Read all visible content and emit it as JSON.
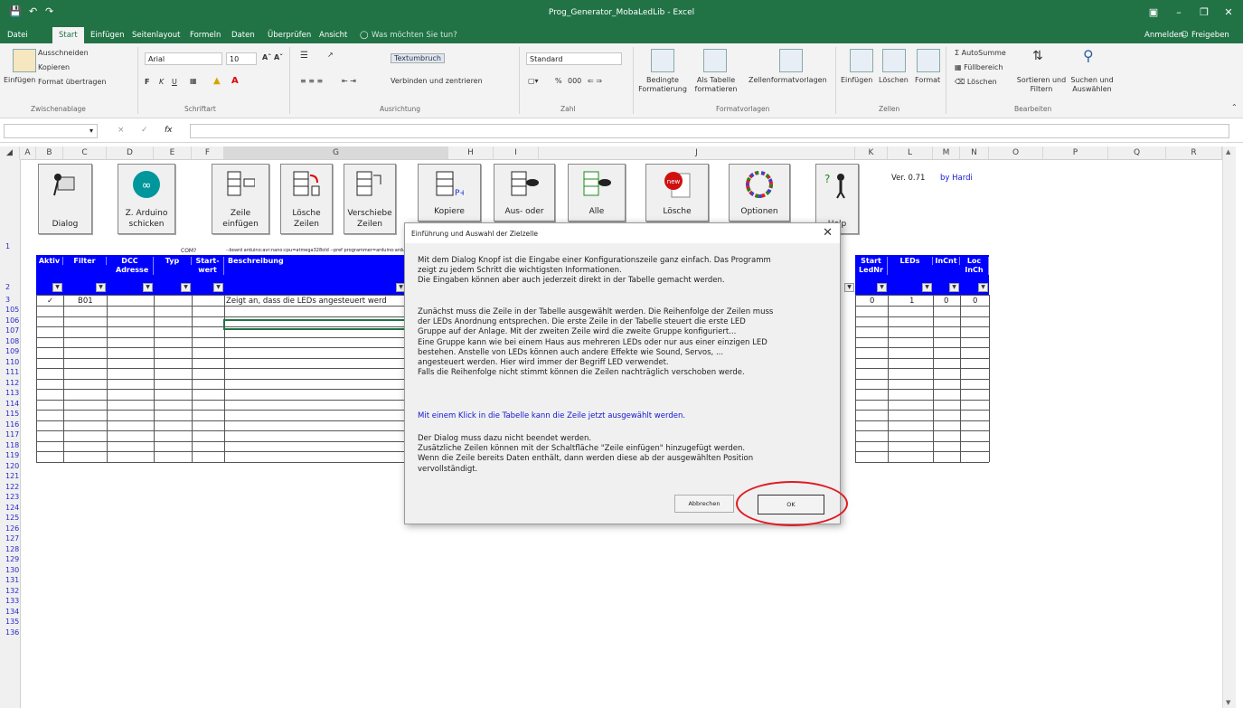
{
  "titlebar": {
    "title": "Prog_Generator_MobaLedLib - Excel",
    "save_icon": "save-icon",
    "undo_icon": "undo-icon",
    "redo_icon": "redo-icon"
  },
  "menu": {
    "items": [
      "Datei",
      "Start",
      "Einfügen",
      "Seitenlayout",
      "Formeln",
      "Daten",
      "Überprüfen",
      "Ansicht"
    ],
    "tell_me": "Was möchten Sie tun?",
    "sign_in": "Anmelden",
    "share": "Freigeben"
  },
  "ribbon": {
    "clipboard": {
      "paste": "Einfügen",
      "cut": "Ausschneiden",
      "copy": "Kopieren",
      "format": "Format übertragen",
      "group": "Zwischenablage"
    },
    "font": {
      "name": "Arial",
      "size": "10",
      "bold": "F",
      "italic": "K",
      "underline": "U",
      "group": "Schriftart"
    },
    "alignment": {
      "wrap": "Textumbruch",
      "merge": "Verbinden und zentrieren",
      "group": "Ausrichtung"
    },
    "number": {
      "format": "Standard",
      "percent": "%",
      "thousands": "000",
      "group": "Zahl"
    },
    "styles": {
      "conditional": "Bedingte Formatierung",
      "as_table": "Als Tabelle formatieren",
      "cell_styles": "Zellenformatvorlagen",
      "group": "Formatvorlagen"
    },
    "cells": {
      "insert": "Einfügen",
      "delete": "Löschen",
      "format": "Format",
      "group": "Zellen"
    },
    "editing": {
      "autosum": "AutoSumme",
      "fill": "Füllbereich",
      "clear": "Löschen",
      "sort": "Sortieren und Filtern",
      "find": "Suchen und Auswählen",
      "group": "Bearbeiten"
    }
  },
  "formula": {
    "cancel": "×",
    "enter": "✓",
    "fx": "fx",
    "value": ""
  },
  "columns": [
    "A",
    "B",
    "C",
    "D",
    "E",
    "F",
    "G",
    "H",
    "I",
    "J",
    "K",
    "L",
    "M",
    "N",
    "O",
    "P",
    "Q",
    "R"
  ],
  "rows": [
    "1",
    "2",
    "3",
    "105",
    "106",
    "107",
    "108",
    "109",
    "110",
    "111",
    "112",
    "113",
    "114",
    "115",
    "116",
    "117",
    "118",
    "119",
    "120",
    "121",
    "122",
    "123",
    "124",
    "125",
    "126",
    "127",
    "128",
    "129",
    "130",
    "131",
    "132",
    "133",
    "134",
    "135",
    "136"
  ],
  "sheet_buttons": [
    {
      "label": "Dialog"
    },
    {
      "label": "Z. Arduino\nschicken"
    },
    {
      "label": "Zeile\neinfügen"
    },
    {
      "label": "Lösche\nZeilen"
    },
    {
      "label": "Verschiebe\nZeilen"
    },
    {
      "label": "Kopiere"
    },
    {
      "label": "Aus- oder"
    },
    {
      "label": "Alle"
    },
    {
      "label": "Lösche"
    },
    {
      "label": "Optionen"
    },
    {
      "label": "Help"
    }
  ],
  "version": {
    "text": "Ver. 0.71",
    "by": "by Hardi"
  },
  "row1": {
    "com": "COM?",
    "board": "--board arduino:avr:nano:cpu=atmega328old --pref programmer=arduino:arduinoisp"
  },
  "table_headers": {
    "aktiv": "Aktiv",
    "filter": "Filter",
    "dcc": "DCC Adresse",
    "typ": "Typ",
    "start": "Start-wert",
    "beschreibung": "Beschreibung",
    "start_led": "Start LedNr",
    "leds": "LEDs",
    "incnt": "InCnt",
    "loc": "Loc InCh"
  },
  "row3": {
    "aktiv": "✓",
    "filter": "B01",
    "beschreibung": "Zeigt an, dass die LEDs angesteuert werd",
    "start_led": "0",
    "leds": "1",
    "incnt": "0",
    "loc": "0"
  },
  "dialog": {
    "title": "Einführung und Auswahl der Zielzelle",
    "p1": [
      "Mit dem Dialog Knopf ist die Eingabe einer Konfigurationszeile ganz einfach. Das Programm",
      "zeigt zu jedem Schritt die wichtigsten Informationen.",
      "Die Eingaben können aber auch jederzeit direkt in der Tabelle gemacht werden."
    ],
    "p2": [
      "Zunächst muss die Zeile in der Tabelle ausgewählt werden. Die Reihenfolge der Zeilen muss",
      "der LEDs Anordnung entsprechen. Die erste Zeile in der Tabelle steuert die erste LED",
      "Gruppe auf der Anlage. Mit der zweiten Zeile wird die zweite Gruppe konfiguriert...",
      "Eine Gruppe kann wie bei einem Haus aus mehreren LEDs oder nur aus einer einzigen LED",
      "bestehen. Anstelle von LEDs können auch andere Effekte wie Sound, Servos, ...",
      "angesteuert werden. Hier wird immer der Begriff LED verwendet.",
      "Falls die Reihenfolge nicht stimmt können die Zeilen nachträglich verschoben werde."
    ],
    "p3": "Mit einem Klick in die Tabelle kann die Zeile jetzt ausgewählt werden.",
    "p4": [
      "Der Dialog muss dazu nicht beendet werden.",
      "Zusätzliche Zeilen können mit der Schaltfläche \"Zeile einfügen\" hinzugefügt werden.",
      "Wenn die Zeile bereits Daten enthält, dann werden diese ab der ausgewählten Position",
      "vervollständigt."
    ],
    "cancel": "Abbrechen",
    "ok": "OK"
  },
  "colors": {
    "excel_green": "#217346",
    "header_blue": "#0000ff",
    "highlight_red": "#e01b24"
  }
}
